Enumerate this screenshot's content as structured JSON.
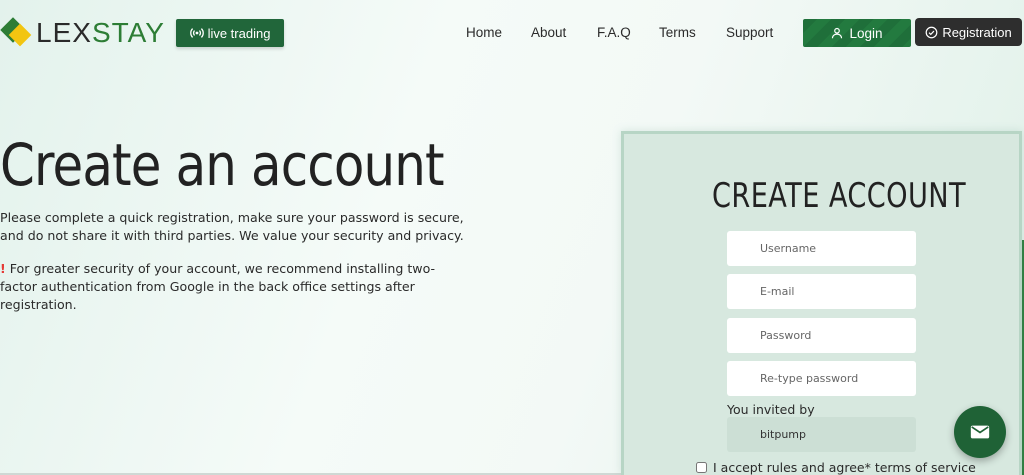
{
  "header": {
    "logo": {
      "text_dark": "LEX",
      "text_accent": "STAY"
    },
    "live_trading_label": "live trading",
    "nav": [
      {
        "label": "Home"
      },
      {
        "label": "About"
      },
      {
        "label": "F.A.Q"
      },
      {
        "label": "Terms"
      },
      {
        "label": "Support"
      }
    ],
    "login_label": "Login",
    "registration_label": "Registration"
  },
  "hero": {
    "title": "Create an account",
    "description": "Please complete a quick registration, make sure your password is secure, and do not share it with third parties. We value your security and privacy.",
    "note_mark": "!",
    "note": "For greater security of your account, we recommend installing two-factor authentication from Google in the back office settings after registration."
  },
  "form": {
    "title": "CREATE ACCOUNT",
    "username_placeholder": "Username",
    "email_placeholder": "E-mail",
    "password_placeholder": "Password",
    "retype_placeholder": "Re-type password",
    "invited_label": "You invited by",
    "invited_value": "bitpump",
    "agree_label": "I accept rules and agree* terms of service"
  },
  "icons": {
    "live": "broadcast-icon",
    "login": "user-icon",
    "registration": "check-circle-icon",
    "mail": "mail-icon",
    "warning": "exclamation-icon"
  },
  "colors": {
    "brand_green": "#21663a",
    "brand_yellow": "#f2c511",
    "registration_bg": "#2e2e2e",
    "panel_bg": "#d7e8df"
  }
}
